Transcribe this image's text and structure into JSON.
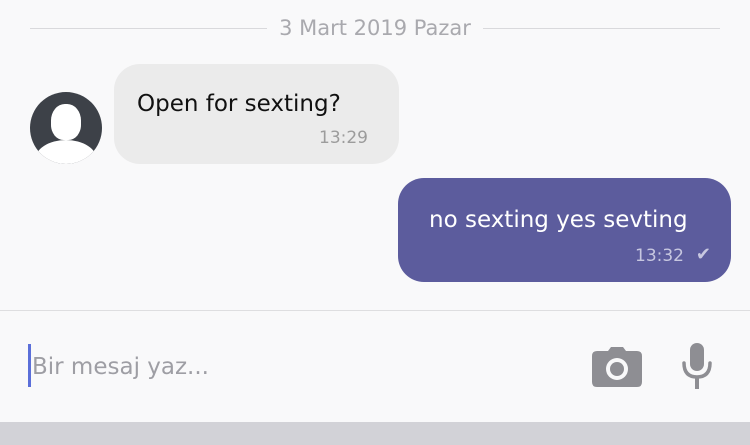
{
  "date_separator": "3 Mart 2019 Pazar",
  "messages": [
    {
      "direction": "incoming",
      "text": "Open for sexting?",
      "time": "13:29"
    },
    {
      "direction": "outgoing",
      "text": "no sexting yes sevting",
      "time": "13:32",
      "status_icon": "check-icon"
    }
  ],
  "composer": {
    "placeholder": "Bir mesaj yaz...",
    "camera_icon": "camera-icon",
    "mic_icon": "microphone-icon"
  },
  "colors": {
    "outgoing_bubble": "#5c5c9d",
    "incoming_bubble": "#ebebeb",
    "cursor": "#5b6fd9"
  }
}
